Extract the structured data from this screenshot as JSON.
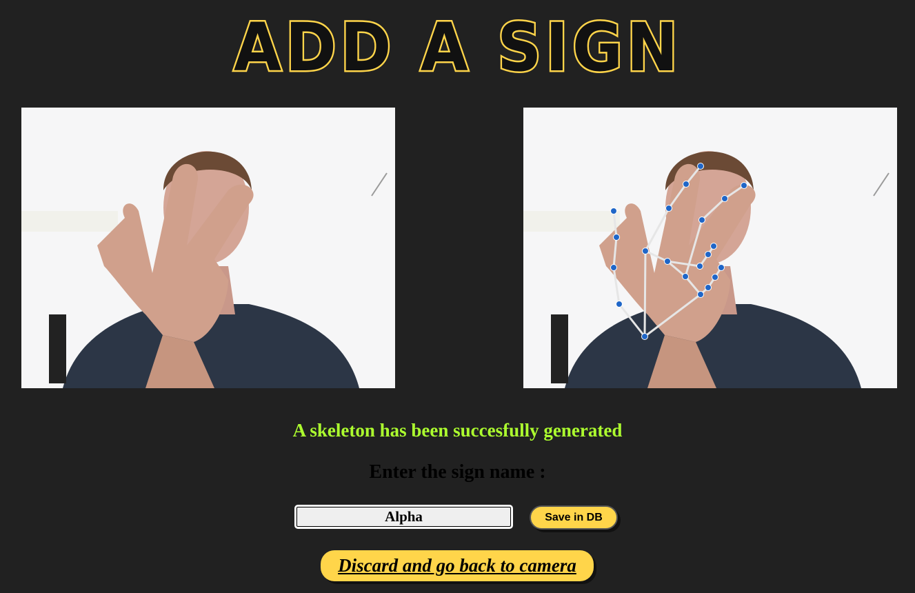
{
  "page": {
    "title": "ADD A SIGN",
    "title_fill": "#111111",
    "title_stroke": "#ffd54a"
  },
  "images": {
    "original": "webcam-capture",
    "skeleton": "skeleton-overlay",
    "joint_color": "#1f66c8",
    "bone_color": "#e6e6e6"
  },
  "status": {
    "message": "A skeleton has been succesfully generated",
    "color": "#adff2f"
  },
  "form": {
    "prompt": "Enter the sign name :",
    "sign_name_value": "Alpha",
    "save_label": "Save in DB",
    "discard_label": "Discard and go back to camera",
    "button_color": "#ffd54a"
  }
}
